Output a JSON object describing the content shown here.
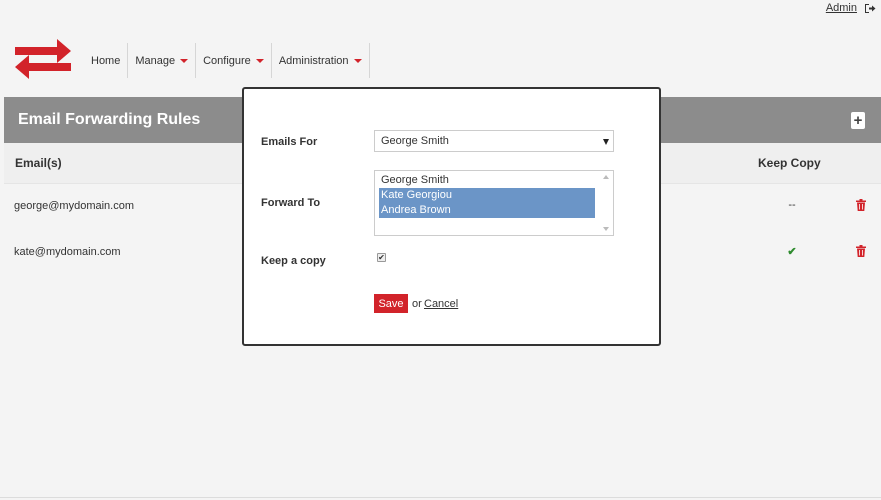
{
  "header": {
    "user_link": "Admin",
    "logout_icon": "logout-icon",
    "logo_icon": "swap-arrows-logo",
    "brand_color": "#d2232a"
  },
  "nav": {
    "items": [
      {
        "label": "Home",
        "has_dropdown": false
      },
      {
        "label": "Manage",
        "has_dropdown": true
      },
      {
        "label": "Configure",
        "has_dropdown": true
      },
      {
        "label": "Administration",
        "has_dropdown": true
      }
    ]
  },
  "page": {
    "title": "Email Forwarding Rules",
    "add_icon": "plus-icon"
  },
  "table": {
    "columns": [
      "Email(s)",
      "Keep Copy"
    ],
    "rows": [
      {
        "email": "george@mydomain.com",
        "keep_copy": "--"
      },
      {
        "email": "kate@mydomain.com",
        "keep_copy": "✔"
      }
    ],
    "delete_icon": "trash-icon"
  },
  "modal": {
    "emails_for_label": "Emails For",
    "emails_for_value": "George Smith",
    "forward_to_label": "Forward To",
    "forward_to_options": [
      {
        "label": "George Smith",
        "selected": false
      },
      {
        "label": "Kate Georgiou",
        "selected": true
      },
      {
        "label": "Andrea Brown",
        "selected": true
      }
    ],
    "keep_copy_label": "Keep a copy",
    "keep_copy_checked": true,
    "checkmark": "✔",
    "save_label": "Save",
    "or_text": "or",
    "cancel_label": "Cancel"
  }
}
